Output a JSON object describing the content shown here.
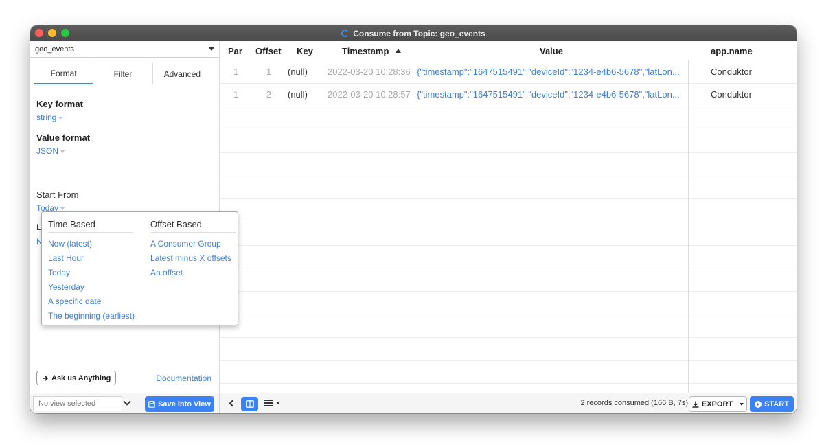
{
  "window": {
    "title": "Consume from Topic: geo_events"
  },
  "left": {
    "topic": "geo_events",
    "tabs": [
      {
        "label": "Format"
      },
      {
        "label": "Filter"
      },
      {
        "label": "Advanced"
      }
    ],
    "key_format_label": "Key format",
    "key_format_value": "string",
    "value_format_label": "Value format",
    "value_format_value": "JSON",
    "start_from_label": "Start From",
    "start_from_value": "Today",
    "hidden_label_initial": "L",
    "hidden_value_initial": "N",
    "ask_button": "Ask us Anything",
    "documentation_link": "Documentation"
  },
  "popup": {
    "time_based": {
      "heading": "Time Based",
      "items": [
        "Now (latest)",
        "Last Hour",
        "Today",
        "Yesterday",
        "A specific date",
        "The beginning (earliest)"
      ]
    },
    "offset_based": {
      "heading": "Offset Based",
      "items": [
        "A Consumer Group",
        "Latest minus X offsets",
        "An offset"
      ]
    }
  },
  "table": {
    "columns": [
      "Par",
      "Offset",
      "Key",
      "Timestamp",
      "Value",
      "app.name"
    ],
    "rows": [
      {
        "par": "1",
        "offset": "1",
        "key": "(null)",
        "timestamp": "2022-03-20 10:28:36",
        "value": "{\"timestamp\":\"1647515491\",\"deviceId\":\"1234-e4b6-5678\",\"latLon...",
        "app_name": "Conduktor"
      },
      {
        "par": "1",
        "offset": "2",
        "key": "(null)",
        "timestamp": "2022-03-20 10:28:57",
        "value": "{\"timestamp\":\"1647515491\",\"deviceId\":\"1234-e4b6-5678\",\"latLon...",
        "app_name": "Conduktor"
      }
    ]
  },
  "footer": {
    "view_placeholder": "No view selected",
    "save_button": "Save into View",
    "records_status": "2 records consumed (166 B, 7s)",
    "export_button": "EXPORT",
    "start_button": "START"
  },
  "colors": {
    "accent": "#3b82f6",
    "link": "#3d7fd4",
    "titlebar": "#4b4b4b"
  }
}
